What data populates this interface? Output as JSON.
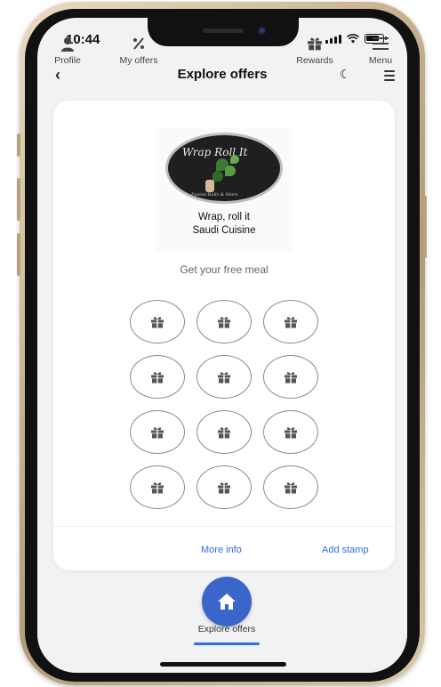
{
  "status_bar": {
    "time": "10:44"
  },
  "header": {
    "title": "Explore offers"
  },
  "brand": {
    "name_line1": "Wrap, roll it",
    "name_line2": "Saudi Cuisine",
    "logo_script": "Wrap Roll It",
    "logo_tagline": "Fusion Rolls & More"
  },
  "offer": {
    "subtitle": "Get your free meal",
    "stamp_count": 12,
    "stamp_icon": "gift-icon"
  },
  "actions": {
    "more_info": "More info",
    "add_stamp": "Add stamp"
  },
  "nav": {
    "items": [
      {
        "label": "Profile",
        "icon": "person-icon"
      },
      {
        "label": "My offers",
        "icon": "percent-icon"
      },
      {
        "label": "Explore offers",
        "icon": "home-icon",
        "active": true
      },
      {
        "label": "Rewards",
        "icon": "gift-icon"
      },
      {
        "label": "Menu",
        "icon": "menu-icon"
      }
    ]
  },
  "colors": {
    "accent": "#2f6fe0",
    "fab": "#3a66cc",
    "screen_bg": "#f2f2f4",
    "card_bg": "#ffffff"
  }
}
